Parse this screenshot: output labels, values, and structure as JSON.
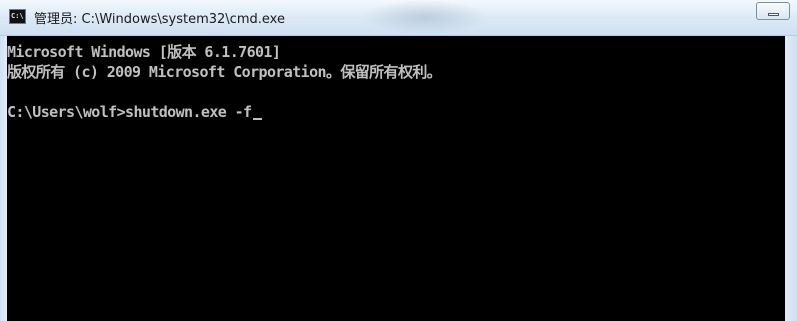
{
  "window": {
    "title": "管理员: C:\\Windows\\system32\\cmd.exe",
    "icon": "cmd-icon",
    "icon_text": "C:\\"
  },
  "console": {
    "lines": [
      "Microsoft Windows [版本 6.1.7601]",
      "版权所有 (c) 2009 Microsoft Corporation。保留所有权利。",
      "",
      "C:\\Users\\wolf>shutdown.exe -f"
    ]
  },
  "colors": {
    "console_background": "#000000",
    "console_text": "#c0c0c0"
  }
}
